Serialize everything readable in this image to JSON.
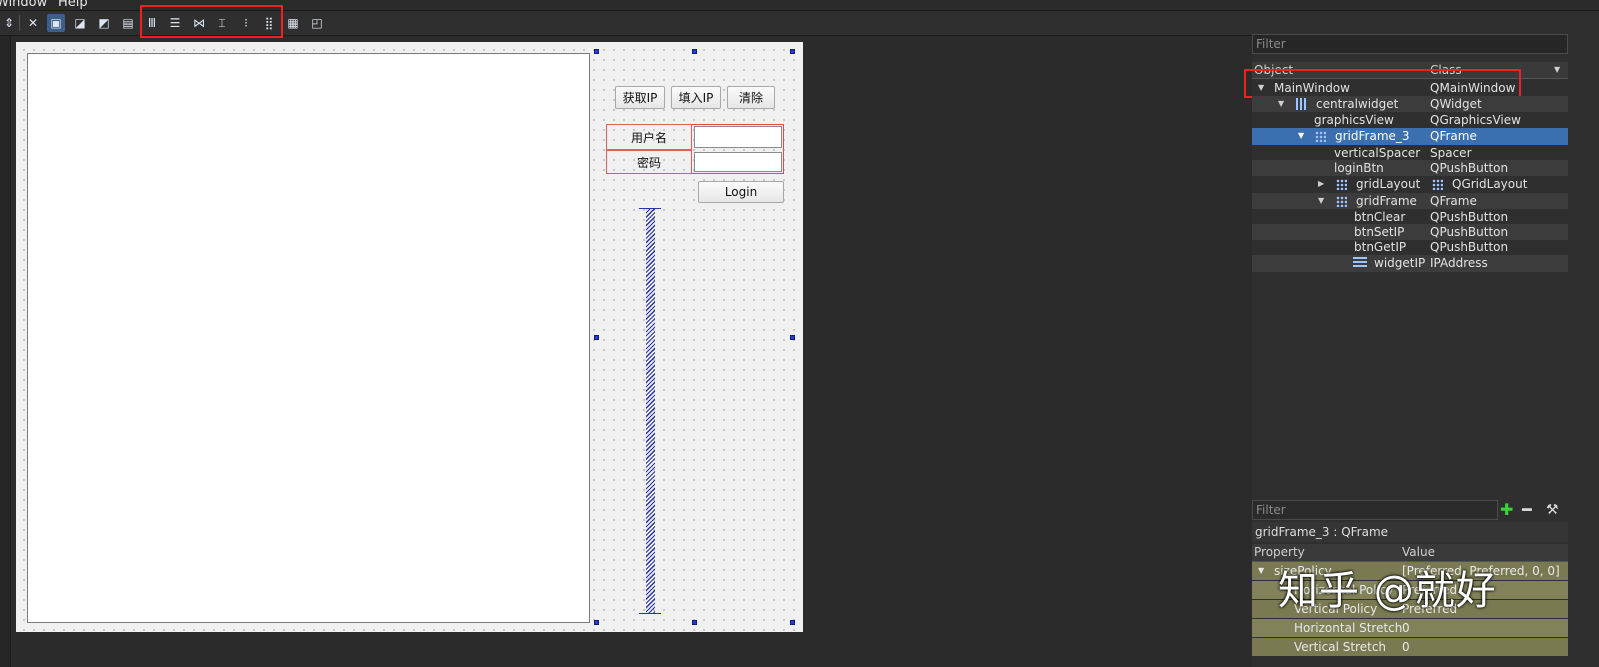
{
  "menu": {
    "window": "Window",
    "help": "Help"
  },
  "form": {
    "buttons": {
      "get_ip": "获取IP",
      "set_ip": "填入IP",
      "clear": "清除"
    },
    "username_label": "用户名",
    "password_label": "密码",
    "login_label": "Login"
  },
  "object_inspector": {
    "filter_placeholder": "Filter",
    "header": {
      "object": "Object",
      "class": "Class"
    },
    "rows": [
      {
        "object": "MainWindow",
        "class": "QMainWindow"
      },
      {
        "object": "centralwidget",
        "class": "QWidget"
      },
      {
        "object": "graphicsView",
        "class": "QGraphicsView"
      },
      {
        "object": "gridFrame_3",
        "class": "QFrame"
      },
      {
        "object": "verticalSpacer",
        "class": "Spacer"
      },
      {
        "object": "loginBtn",
        "class": "QPushButton"
      },
      {
        "object": "gridLayout",
        "class": "QGridLayout"
      },
      {
        "object": "gridFrame",
        "class": "QFrame"
      },
      {
        "object": "btnClear",
        "class": "QPushButton"
      },
      {
        "object": "btnSetIP",
        "class": "QPushButton"
      },
      {
        "object": "btnGetIP",
        "class": "QPushButton"
      },
      {
        "object": "widgetIP",
        "class": "IPAddress"
      }
    ]
  },
  "property_editor": {
    "filter_placeholder": "Filter",
    "title": "gridFrame_3 : QFrame",
    "header": {
      "property": "Property",
      "value": "Value"
    },
    "rows": [
      {
        "name": "sizePolicy",
        "value": "[Preferred, Preferred, 0, 0]"
      },
      {
        "name": "Horizontal Policy",
        "value": "Preferred"
      },
      {
        "name": "Vertical Policy",
        "value": "Preferred"
      },
      {
        "name": "Horizontal Stretch",
        "value": "0"
      },
      {
        "name": "Vertical Stretch",
        "value": "0"
      }
    ]
  },
  "watermark": "知乎 @就好",
  "colors": {
    "selection": "#3b6fb0",
    "highlight_box": "#ee2222",
    "property_row": "#7a7a52"
  }
}
